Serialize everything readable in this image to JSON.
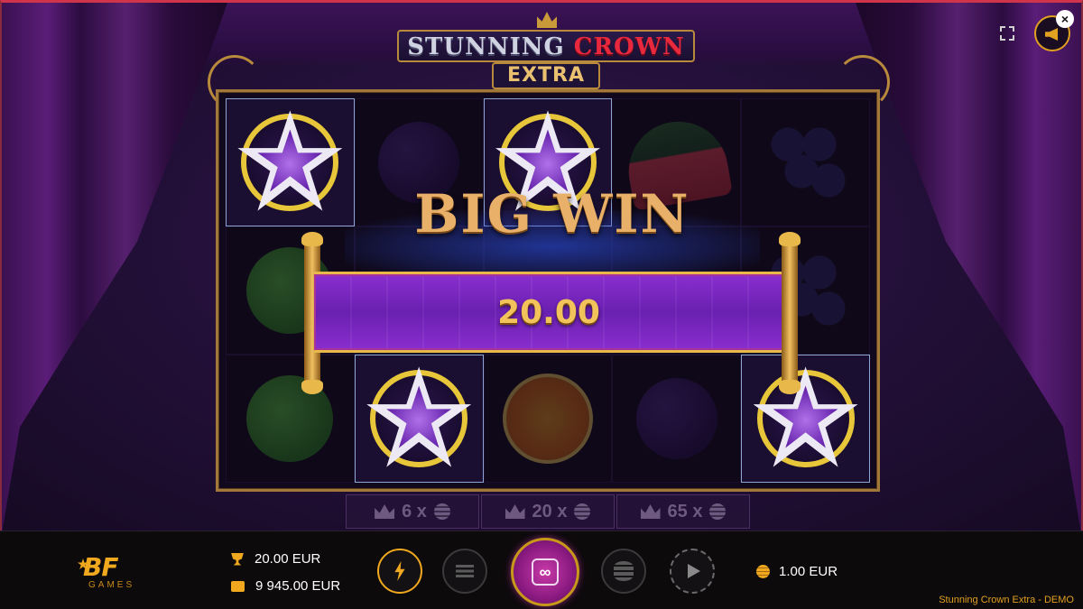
{
  "game": {
    "logo_line1_word1": "STUNNING",
    "logo_line1_word2": "CROWN",
    "logo_line2": "EXTRA",
    "demo_label": "Stunning Crown Extra - DEMO"
  },
  "win_overlay": {
    "headline": "BIG WIN",
    "amount": "20.00"
  },
  "reels": [
    [
      "star",
      "plum",
      "star",
      "watermelon",
      "grapes"
    ],
    [
      "lime",
      "empty",
      "empty",
      "empty",
      "grapes"
    ],
    [
      "lime",
      "star",
      "orange",
      "plum",
      "star"
    ]
  ],
  "winning_cells": [
    [
      0,
      0
    ],
    [
      0,
      2
    ],
    [
      2,
      1
    ],
    [
      2,
      4
    ]
  ],
  "paytable": [
    {
      "icon": "crown-icon",
      "label": "6 x"
    },
    {
      "icon": "crown-icon",
      "label": "20 x"
    },
    {
      "icon": "crown-icon",
      "label": "65 x"
    }
  ],
  "bottom_bar": {
    "brand": "BF",
    "brand_sub": "GAMES",
    "last_win": "20.00 EUR",
    "balance": "9 945.00 EUR",
    "bet": "1.00 EUR",
    "spin_symbol": "∞"
  },
  "colors": {
    "accent_gold": "#f0a81e",
    "spin_magenta": "#c83aa8",
    "banner_purple": "#8a2ed0",
    "win_border": "#8ea6d6"
  }
}
